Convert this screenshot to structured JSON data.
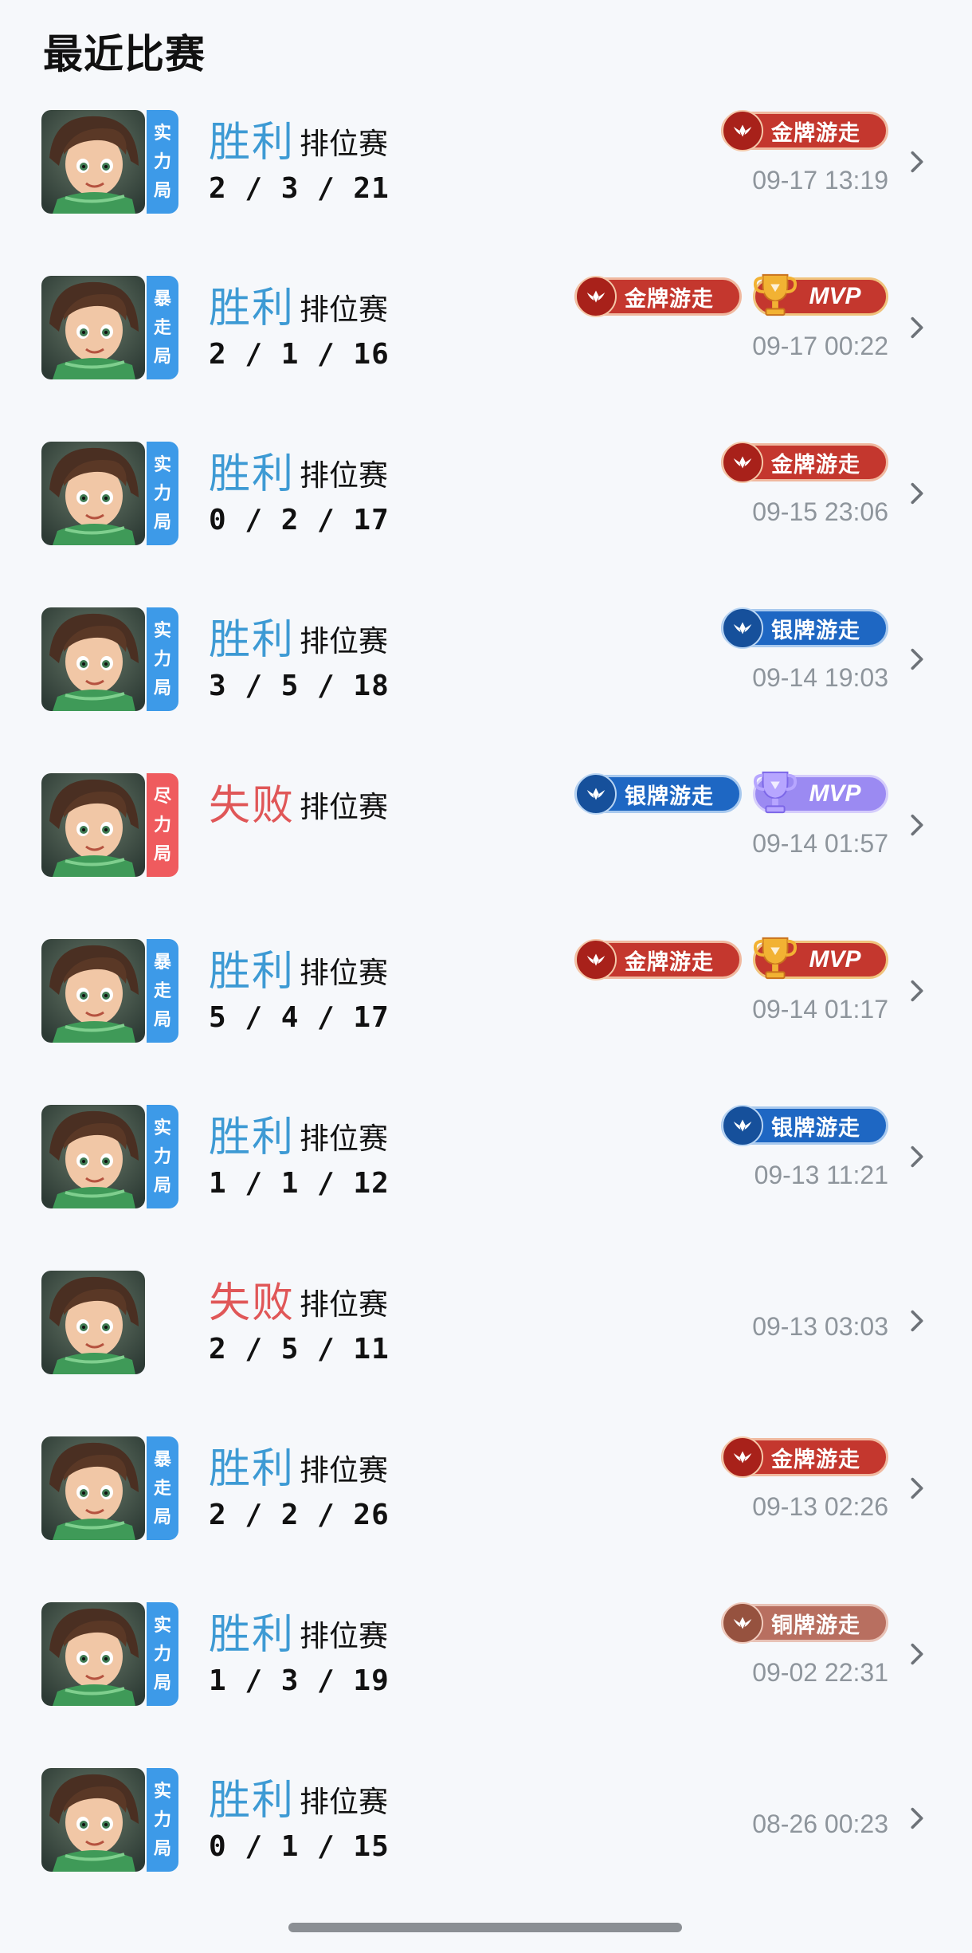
{
  "page": {
    "title": "最近比赛"
  },
  "colors": {
    "win": "#3d9ad4",
    "lose": "#e05758",
    "tag_blue": "#3d9ae8",
    "tag_red": "#ef5b5e"
  },
  "matches": [
    {
      "result": "胜利",
      "outcome": "win",
      "mode": "排位赛",
      "kda": "2 / 3 / 21",
      "time": "09-17 13:19",
      "tag": [
        "实",
        "力",
        "局"
      ],
      "tag_color": "blue",
      "badges": [
        {
          "label": "金牌游走",
          "kind": "gold"
        }
      ],
      "mvp": null
    },
    {
      "result": "胜利",
      "outcome": "win",
      "mode": "排位赛",
      "kda": "2 / 1 / 16",
      "time": "09-17 00:22",
      "tag": [
        "暴",
        "走",
        "局"
      ],
      "tag_color": "blue",
      "badges": [
        {
          "label": "金牌游走",
          "kind": "gold"
        }
      ],
      "mvp": {
        "label": "MVP",
        "kind": "gold"
      }
    },
    {
      "result": "胜利",
      "outcome": "win",
      "mode": "排位赛",
      "kda": "0 / 2 / 17",
      "time": "09-15 23:06",
      "tag": [
        "实",
        "力",
        "局"
      ],
      "tag_color": "blue",
      "badges": [
        {
          "label": "金牌游走",
          "kind": "gold"
        }
      ],
      "mvp": null
    },
    {
      "result": "胜利",
      "outcome": "win",
      "mode": "排位赛",
      "kda": "3 / 5 / 18",
      "time": "09-14 19:03",
      "tag": [
        "实",
        "力",
        "局"
      ],
      "tag_color": "blue",
      "badges": [
        {
          "label": "银牌游走",
          "kind": "silver"
        }
      ],
      "mvp": null
    },
    {
      "result": "失败",
      "outcome": "lose",
      "mode": "排位赛",
      "kda": "",
      "time": "09-14 01:57",
      "tag": [
        "尽",
        "力",
        "局"
      ],
      "tag_color": "red",
      "badges": [
        {
          "label": "银牌游走",
          "kind": "silver"
        }
      ],
      "mvp": {
        "label": "MVP",
        "kind": "purple"
      }
    },
    {
      "result": "胜利",
      "outcome": "win",
      "mode": "排位赛",
      "kda": "5 / 4 / 17",
      "time": "09-14 01:17",
      "tag": [
        "暴",
        "走",
        "局"
      ],
      "tag_color": "blue",
      "badges": [
        {
          "label": "金牌游走",
          "kind": "gold"
        }
      ],
      "mvp": {
        "label": "MVP",
        "kind": "gold"
      }
    },
    {
      "result": "胜利",
      "outcome": "win",
      "mode": "排位赛",
      "kda": "1 / 1 / 12",
      "time": "09-13 11:21",
      "tag": [
        "实",
        "力",
        "局"
      ],
      "tag_color": "blue",
      "badges": [
        {
          "label": "银牌游走",
          "kind": "silver"
        }
      ],
      "mvp": null
    },
    {
      "result": "失败",
      "outcome": "lose",
      "mode": "排位赛",
      "kda": "2 / 5 / 11",
      "time": "09-13 03:03",
      "tag": null,
      "tag_color": null,
      "badges": [],
      "mvp": null
    },
    {
      "result": "胜利",
      "outcome": "win",
      "mode": "排位赛",
      "kda": "2 / 2 / 26",
      "time": "09-13 02:26",
      "tag": [
        "暴",
        "走",
        "局"
      ],
      "tag_color": "blue",
      "badges": [
        {
          "label": "金牌游走",
          "kind": "gold"
        }
      ],
      "mvp": null
    },
    {
      "result": "胜利",
      "outcome": "win",
      "mode": "排位赛",
      "kda": "1 / 3 / 19",
      "time": "09-02 22:31",
      "tag": [
        "实",
        "力",
        "局"
      ],
      "tag_color": "blue",
      "badges": [
        {
          "label": "铜牌游走",
          "kind": "bronze"
        }
      ],
      "mvp": null
    },
    {
      "result": "胜利",
      "outcome": "win",
      "mode": "排位赛",
      "kda": "0 / 1 / 15",
      "time": "08-26 00:23",
      "tag": [
        "实",
        "力",
        "局"
      ],
      "tag_color": "blue",
      "badges": [],
      "mvp": null
    }
  ]
}
